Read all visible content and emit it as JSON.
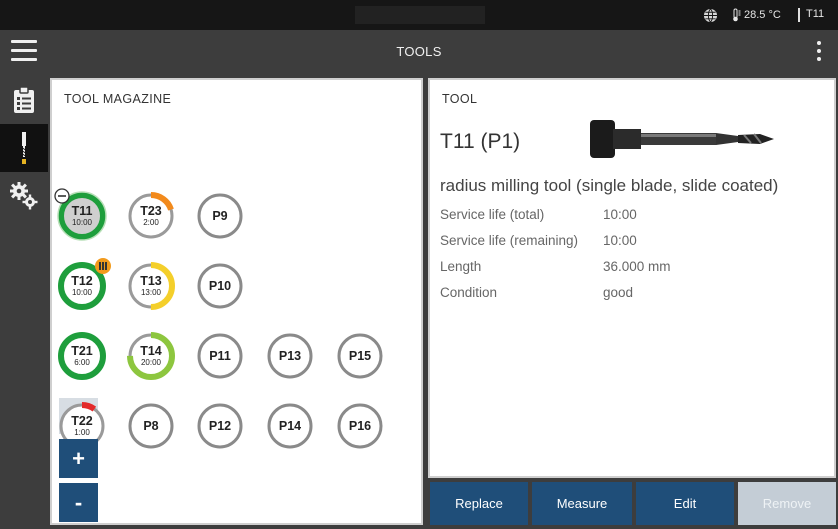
{
  "statusbar": {
    "temperature": "28.5 °C",
    "active_tool": "T11"
  },
  "titlebar": {
    "title": "TOOLS"
  },
  "magazine": {
    "title": "TOOL MAGAZINE",
    "pockets": [
      {
        "id": "T11",
        "time": "10:00",
        "status": "good",
        "level": 1.0,
        "color": "#1e9e3c",
        "badge": "minus"
      },
      {
        "id": "T23",
        "time": "2:00",
        "status": "warning",
        "level": 0.2,
        "color": "#f28a1c",
        "badge": ""
      },
      {
        "id": "P9",
        "time": "",
        "status": "empty",
        "level": 0,
        "color": "#8a8a8a",
        "badge": ""
      },
      {
        "id": "T12",
        "time": "10:00",
        "status": "good",
        "level": 1.0,
        "color": "#1e9e3c",
        "badge": "info"
      },
      {
        "id": "T13",
        "time": "13:00",
        "status": "caution",
        "level": 0.5,
        "color": "#f4cf2b",
        "badge": ""
      },
      {
        "id": "P10",
        "time": "",
        "status": "empty",
        "level": 0,
        "color": "#8a8a8a",
        "badge": ""
      },
      {
        "id": "T21",
        "time": "6:00",
        "status": "good",
        "level": 1.0,
        "color": "#1e9e3c",
        "badge": ""
      },
      {
        "id": "T14",
        "time": "20:00",
        "status": "good",
        "level": 0.75,
        "color": "#8dc63f",
        "badge": ""
      },
      {
        "id": "P11",
        "time": "",
        "status": "empty",
        "level": 0,
        "color": "#8a8a8a",
        "badge": ""
      },
      {
        "id": "P13",
        "time": "",
        "status": "empty",
        "level": 0,
        "color": "#8a8a8a",
        "badge": ""
      },
      {
        "id": "P15",
        "time": "",
        "status": "empty",
        "level": 0,
        "color": "#8a8a8a",
        "badge": ""
      },
      {
        "id": "T22",
        "time": "1:00",
        "status": "critical",
        "level": 0.1,
        "color": "#e32a2a",
        "badge": ""
      },
      {
        "id": "P8",
        "time": "",
        "status": "empty",
        "level": 0,
        "color": "#8a8a8a",
        "badge": ""
      },
      {
        "id": "P12",
        "time": "",
        "status": "empty",
        "level": 0,
        "color": "#8a8a8a",
        "badge": ""
      },
      {
        "id": "P14",
        "time": "",
        "status": "empty",
        "level": 0,
        "color": "#8a8a8a",
        "badge": ""
      },
      {
        "id": "P16",
        "time": "",
        "status": "empty",
        "level": 0,
        "color": "#8a8a8a",
        "badge": ""
      }
    ],
    "zoom_in_label": "+",
    "zoom_out_label": "-"
  },
  "tool": {
    "title": "TOOL",
    "name": "T11 (P1)",
    "description": "radius milling tool (single blade, slide coated)",
    "properties": [
      {
        "key": "Service life (total)",
        "value": "10:00"
      },
      {
        "key": "Service life (remaining)",
        "value": "10:00"
      },
      {
        "key": "Length",
        "value": "36.000 mm"
      },
      {
        "key": "Condition",
        "value": "good"
      }
    ]
  },
  "actions": {
    "replace": "Replace",
    "measure": "Measure",
    "edit": "Edit",
    "remove": "Remove"
  },
  "colors": {
    "primary": "#1f4e79",
    "disabled": "#c4cdd6",
    "good": "#1e9e3c",
    "warning": "#f28a1c",
    "caution": "#f4cf2b",
    "critical": "#e32a2a"
  }
}
